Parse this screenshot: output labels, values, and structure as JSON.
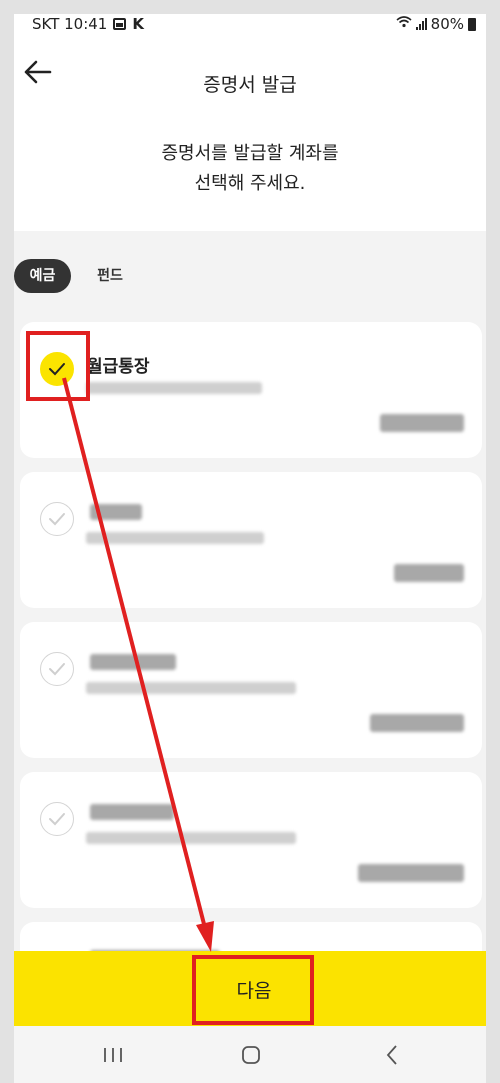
{
  "status_bar": {
    "carrier_time": "SKT 10:41",
    "k_app": "K",
    "battery": "80%"
  },
  "header": {
    "title": "증명서 발급"
  },
  "instruction": {
    "line1": "증명서를 발급할 계좌를",
    "line2": "선택해 주세요."
  },
  "tabs": [
    {
      "label": "예금",
      "active": true
    },
    {
      "label": "펀드",
      "active": false
    }
  ],
  "accounts": [
    {
      "name": "월급통장",
      "selected": true
    }
  ],
  "footer": {
    "next_label": "다음"
  },
  "colors": {
    "accent_yellow": "#fbe300",
    "annotation_red": "#e02020"
  }
}
